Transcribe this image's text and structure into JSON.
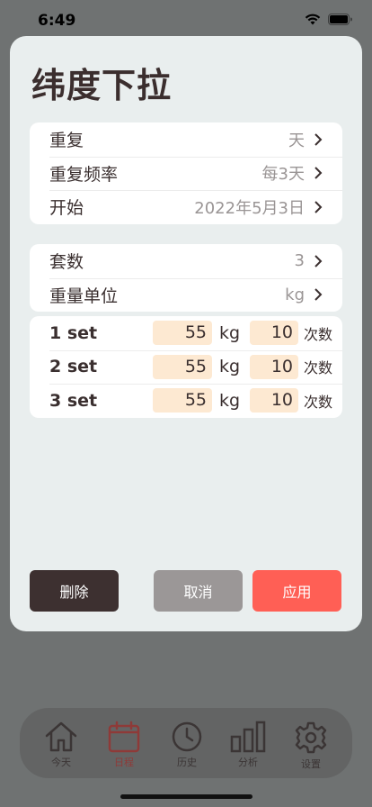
{
  "status": {
    "time": "6:49"
  },
  "sheet": {
    "title": "纬度下拉",
    "schedule": [
      {
        "label": "重复",
        "value": "天"
      },
      {
        "label": "重复频率",
        "value": "每3天"
      },
      {
        "label": "开始",
        "value": "2022年5月3日"
      }
    ],
    "config": [
      {
        "label": "套数",
        "value": "3"
      },
      {
        "label": "重量单位",
        "value": "kg"
      }
    ],
    "sets": [
      {
        "label": "1 set",
        "weight": "55",
        "unit": "kg",
        "reps": "10",
        "reps_unit": "次数"
      },
      {
        "label": "2 set",
        "weight": "55",
        "unit": "kg",
        "reps": "10",
        "reps_unit": "次数"
      },
      {
        "label": "3 set",
        "weight": "55",
        "unit": "kg",
        "reps": "10",
        "reps_unit": "次数"
      }
    ],
    "buttons": {
      "delete": "删除",
      "cancel": "取消",
      "apply": "应用"
    }
  },
  "tabbar": {
    "items": [
      {
        "label": "今天",
        "icon": "home-icon"
      },
      {
        "label": "日程",
        "icon": "calendar-icon",
        "active": true
      },
      {
        "label": "历史",
        "icon": "clock-icon"
      },
      {
        "label": "分析",
        "icon": "bar-chart-icon"
      },
      {
        "label": "设置",
        "icon": "gear-icon"
      }
    ]
  },
  "colors": {
    "accent_apply": "#ff5f55",
    "delete_bg": "#3d3030",
    "cancel_bg": "#9b9797",
    "input_bg": "#fde9d2",
    "active_tab": "#8e3a38"
  }
}
